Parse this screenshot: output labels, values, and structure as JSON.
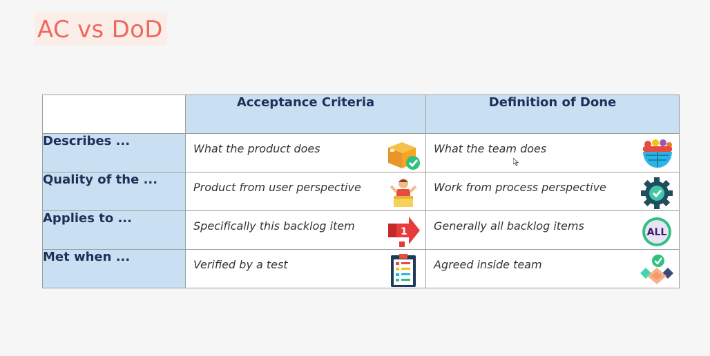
{
  "title": "AC vs DoD",
  "table": {
    "headers": [
      "Acceptance Criteria",
      "Definition of Done"
    ],
    "rows": [
      {
        "label": "Describes ...",
        "ac": "What the product does",
        "dod": "What the team does",
        "ac_icon": "package-check-icon",
        "dod_icon": "team-globe-icon"
      },
      {
        "label": "Quality of the ...",
        "ac": "Product from user perspective",
        "dod": "Work from process perspective",
        "ac_icon": "user-box-icon",
        "dod_icon": "gear-check-icon"
      },
      {
        "label": "Applies to ...",
        "ac": "Specifically this backlog item",
        "dod": "Generally all backlog items",
        "ac_icon": "arrow-one-icon",
        "dod_icon": "all-badge-icon"
      },
      {
        "label": "Met when ...",
        "ac": "Verified by a test",
        "dod": "Agreed inside team",
        "ac_icon": "checklist-icon",
        "dod_icon": "handshake-check-icon"
      }
    ],
    "badge_text": "ALL",
    "arrow_text": "1"
  },
  "colors": {
    "title": "#f0685c",
    "header_bg": "#c9e0f2",
    "header_text": "#1f2f5a"
  }
}
